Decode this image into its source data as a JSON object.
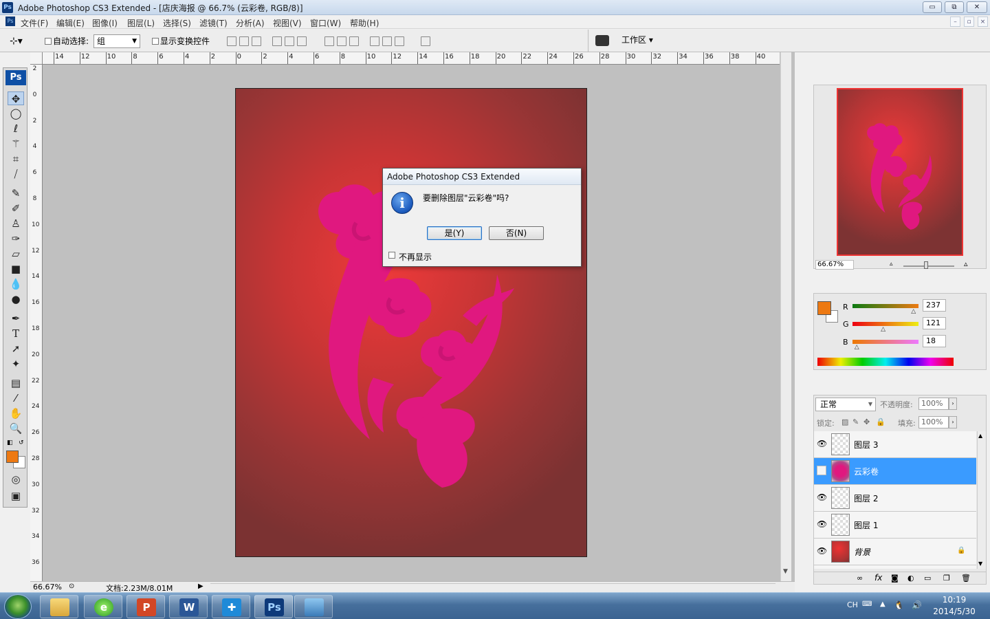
{
  "window": {
    "title": "Adobe Photoshop CS3 Extended - [店庆海报 @ 66.7% (云彩卷, RGB/8)]",
    "minimize": "▭",
    "restore": "⧉",
    "close": "✕"
  },
  "menu": [
    "文件(F)",
    "编辑(E)",
    "图像(I)",
    "图层(L)",
    "选择(S)",
    "滤镜(T)",
    "分析(A)",
    "视图(V)",
    "窗口(W)",
    "帮助(H)"
  ],
  "options": {
    "auto_select_label": "自动选择:",
    "auto_select_value": "组",
    "show_transform_label": "显示变换控件",
    "workspace_label": "工作区 ▾"
  },
  "rulers": {
    "top": [
      "14",
      "12",
      "10",
      "8",
      "6",
      "4",
      "2",
      "0",
      "2",
      "4",
      "6",
      "8",
      "10",
      "12",
      "14",
      "16",
      "18",
      "20",
      "22",
      "24",
      "26",
      "28",
      "30",
      "32",
      "34",
      "36",
      "38",
      "40"
    ],
    "left": [
      "2",
      "0",
      "2",
      "4",
      "6",
      "8",
      "10",
      "12",
      "14",
      "16",
      "18",
      "20",
      "22",
      "24",
      "26",
      "28",
      "30",
      "32",
      "34",
      "36"
    ]
  },
  "dialog": {
    "title": "Adobe Photoshop CS3 Extended",
    "message": "要删除图层\"云彩卷\"吗?",
    "yes": "是(Y)",
    "no": "否(N)",
    "dont_show": "不再显示",
    "info_glyph": "i"
  },
  "status": {
    "zoom": "66.67%",
    "doc_info": "文档:2.23M/8.01M"
  },
  "navigator": {
    "zoom": "66.67%"
  },
  "color_panel": {
    "channels": [
      {
        "label": "R",
        "value": "237",
        "level": 0.93
      },
      {
        "label": "G",
        "value": "121",
        "level": 0.47
      },
      {
        "label": "B",
        "value": "18",
        "level": 0.07
      }
    ],
    "foreground": "#ed7912"
  },
  "layers_panel": {
    "blend_mode": "正常",
    "opacity_label": "不透明度:",
    "opacity_value": "100%",
    "lock_label": "锁定:",
    "fill_label": "填充:",
    "fill_value": "100%",
    "layers": [
      {
        "name": "图层 3",
        "visible": true,
        "selected": false
      },
      {
        "name": "云彩卷",
        "visible": false,
        "selected": true
      },
      {
        "name": "图层 2",
        "visible": true,
        "selected": false
      },
      {
        "name": "图层 1",
        "visible": true,
        "selected": false
      },
      {
        "name": "背景",
        "visible": true,
        "selected": false
      }
    ],
    "footer_icons": [
      "link-icon",
      "fx-icon",
      "mask-icon",
      "adjustment-icon",
      "folder-icon",
      "new-layer-icon",
      "trash-icon"
    ]
  },
  "taskbar": {
    "apps": [
      "explorer",
      "360",
      "powerpoint",
      "word",
      "app5",
      "photoshop",
      "picture"
    ],
    "ime": "CH",
    "time": "10:19",
    "date": "2014/5/30"
  },
  "colors": {
    "accent": "#3a9bff",
    "artwork": "#e0187f"
  }
}
